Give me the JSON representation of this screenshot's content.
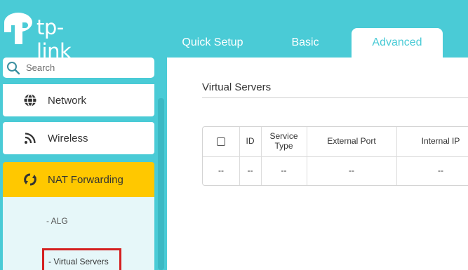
{
  "brand": {
    "logo_text": "tp-link"
  },
  "tabs": [
    {
      "label": "Quick Setup"
    },
    {
      "label": "Basic"
    },
    {
      "label": "Advanced"
    }
  ],
  "sidebar": {
    "search_placeholder": "Search",
    "items": [
      {
        "label": "Network",
        "icon": "globe-icon"
      },
      {
        "label": "Wireless",
        "icon": "wifi-icon"
      },
      {
        "label": "NAT Forwarding",
        "icon": "nat-forwarding-icon"
      }
    ],
    "nat_subitems": [
      {
        "label": "- ALG"
      },
      {
        "label": "- Virtual Servers"
      }
    ]
  },
  "main": {
    "section_title": "Virtual Servers",
    "table": {
      "headers": [
        "ID",
        "Service Type",
        "External Port",
        "Internal IP"
      ],
      "row": [
        "--",
        "--",
        "--",
        "--",
        "--"
      ]
    }
  },
  "colors": {
    "teal": "#4acbd6",
    "active_menu": "#ffc800",
    "highlight_box": "#d42020"
  }
}
